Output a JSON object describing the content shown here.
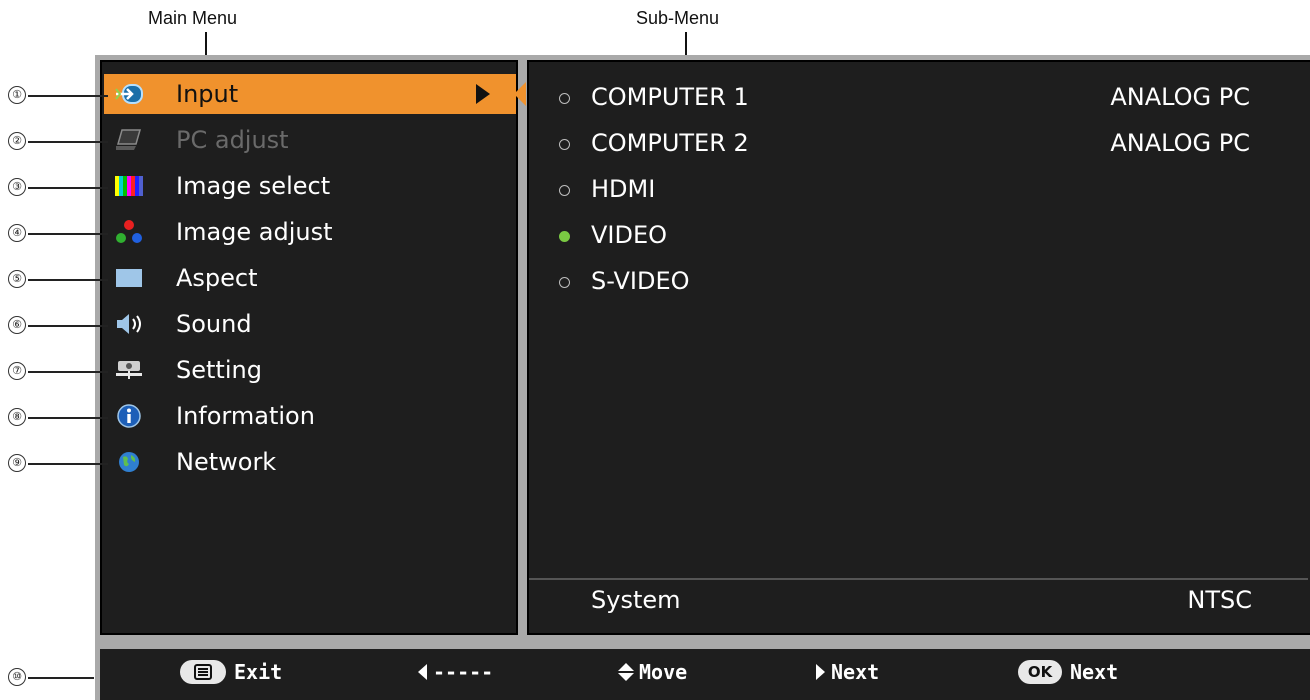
{
  "callouts": {
    "main_menu": "Main Menu",
    "sub_menu": "Sub-Menu",
    "numbers": [
      "①",
      "②",
      "③",
      "④",
      "⑤",
      "⑥",
      "⑦",
      "⑧",
      "⑨",
      "⑩"
    ]
  },
  "main_menu": {
    "items": [
      {
        "label": "Input",
        "icon": "input-icon",
        "state": "active"
      },
      {
        "label": "PC adjust",
        "icon": "pc-adjust-icon",
        "state": "disabled"
      },
      {
        "label": "Image select",
        "icon": "image-select-icon",
        "state": "normal"
      },
      {
        "label": "Image adjust",
        "icon": "image-adjust-icon",
        "state": "normal"
      },
      {
        "label": "Aspect",
        "icon": "aspect-icon",
        "state": "normal"
      },
      {
        "label": "Sound",
        "icon": "sound-icon",
        "state": "normal"
      },
      {
        "label": "Setting",
        "icon": "setting-icon",
        "state": "normal"
      },
      {
        "label": "Information",
        "icon": "information-icon",
        "state": "normal"
      },
      {
        "label": "Network",
        "icon": "network-icon",
        "state": "normal"
      }
    ]
  },
  "sub_menu": {
    "items": [
      {
        "label": "COMPUTER 1",
        "value": "ANALOG PC",
        "selected": false
      },
      {
        "label": "COMPUTER 2",
        "value": "ANALOG PC",
        "selected": false
      },
      {
        "label": "HDMI",
        "value": "",
        "selected": false
      },
      {
        "label": "VIDEO",
        "value": "",
        "selected": true
      },
      {
        "label": "S-VIDEO",
        "value": "",
        "selected": false
      }
    ],
    "system": {
      "label": "System",
      "value": "NTSC"
    }
  },
  "bottom_bar": {
    "exit": "Exit",
    "back": "-----",
    "move": "Move",
    "next": "Next",
    "ok_key": "OK",
    "ok_next": "Next"
  },
  "colors": {
    "active_highlight": "#f0922d",
    "selected_radio": "#7ac943",
    "panel_bg": "#1e1e1e",
    "frame_gray": "#a9a9a9"
  }
}
